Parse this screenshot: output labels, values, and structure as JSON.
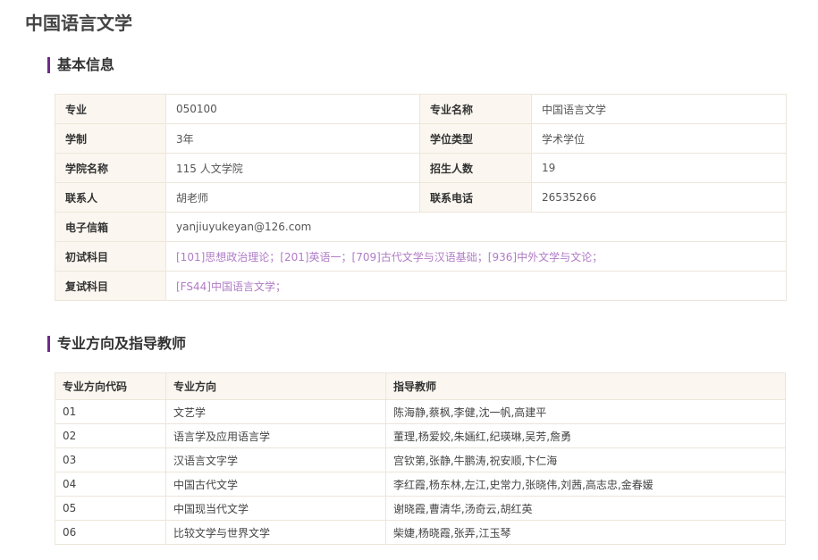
{
  "page": {
    "title": "中国语言文学"
  },
  "basic_info": {
    "title": "基本信息",
    "major_label": "专业",
    "major_value": "050100",
    "major_name_label": "专业名称",
    "major_name_value": "中国语言文学",
    "duration_label": "学制",
    "duration_value": "3年",
    "degree_type_label": "学位类型",
    "degree_type_value": "学术学位",
    "college_label": "学院名称",
    "college_value": "115 人文学院",
    "enrollment_label": "招生人数",
    "enrollment_value": "19",
    "contact_label": "联系人",
    "contact_value": "胡老师",
    "phone_label": "联系电话",
    "phone_value": "26535266",
    "email_label": "电子信箱",
    "email_value": "yanjiuyukeyan@126.com",
    "prelim_label": "初试科目",
    "prelim_value": "[101]思想政治理论；[201]英语一；[709]古代文学与汉语基础；[936]中外文学与文论；",
    "retest_label": "复试科目",
    "retest_value": "[FS44]中国语言文学；"
  },
  "directions": {
    "title": "专业方向及指导教师",
    "headers": [
      "专业方向代码",
      "专业方向",
      "指导教师"
    ],
    "rows": [
      [
        "01",
        "文艺学",
        "陈海静,蔡枫,李健,沈一帆,高建平"
      ],
      [
        "02",
        "语言学及应用语言学",
        "董理,杨爱姣,朱婳红,纪瑛琳,吴芳,詹勇"
      ],
      [
        "03",
        "汉语言文字学",
        "宫钦第,张静,牛鹏涛,祝安顺,卞仁海"
      ],
      [
        "04",
        "中国古代文学",
        "李红霞,杨东林,左江,史常力,张晓伟,刘茜,高志忠,金春媛"
      ],
      [
        "05",
        "中国现当代文学",
        "谢晓霞,曹清华,汤奇云,胡红英"
      ],
      [
        "06",
        "比较文学与世界文学",
        "柴婕,杨晓霞,张弄,江玉琴"
      ]
    ]
  }
}
